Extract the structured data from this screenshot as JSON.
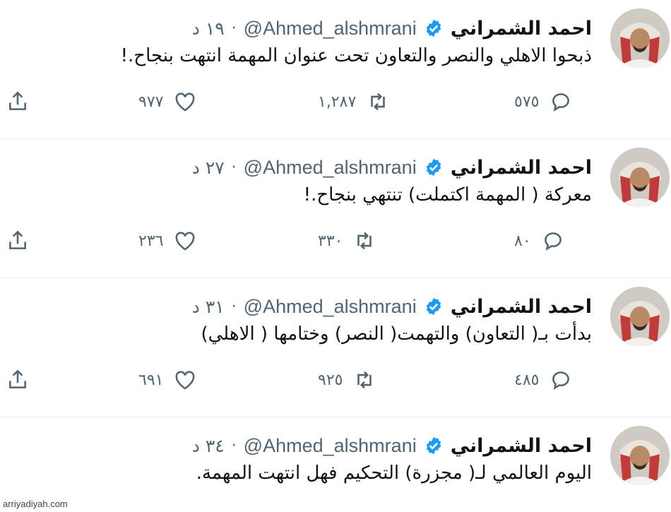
{
  "colors": {
    "accent": "#1d9bf0",
    "text": "#0f1419",
    "muted": "#536471",
    "divider": "#e6ecf0"
  },
  "tweets": [
    {
      "name": "احمد الشمراني",
      "handle": "@Ahmed_alshmrani",
      "separator": "·",
      "time": "١٩ د",
      "text": "ذبحوا الاهلي والنصر والتعاون تحت عنوان المهمة انتهت بنجاح.!",
      "replies": "٥٧٥",
      "retweets": "١,٢٨٧",
      "likes": "٩٧٧"
    },
    {
      "name": "احمد الشمراني",
      "handle": "@Ahmed_alshmrani",
      "separator": "·",
      "time": "٢٧ د",
      "text": "معركة ( المهمة اكتملت) تنتهي بنجاح.!",
      "replies": "٨٠",
      "retweets": "٣٣٠",
      "likes": "٢٣٦"
    },
    {
      "name": "احمد الشمراني",
      "handle": "@Ahmed_alshmrani",
      "separator": "·",
      "time": "٣١ د",
      "text": "بدأت بـ( التعاون) والتهمت( النصر) وختامها ( الاهلي)",
      "replies": "٤٨٥",
      "retweets": "٩٢٥",
      "likes": "٦٩١"
    },
    {
      "name": "احمد الشمراني",
      "handle": "@Ahmed_alshmrani",
      "separator": "·",
      "time": "٣٤ د",
      "text": "اليوم العالمي لـ( مجزرة) التحكيم فهل انتهت المهمة.",
      "replies": "",
      "retweets": "",
      "likes": ""
    }
  ],
  "icons": {
    "reply": "reply-icon",
    "retweet": "retweet-icon",
    "like": "heart-icon",
    "share": "share-icon",
    "verified": "verified-badge-icon"
  },
  "watermark": "arriyadiyah.com"
}
